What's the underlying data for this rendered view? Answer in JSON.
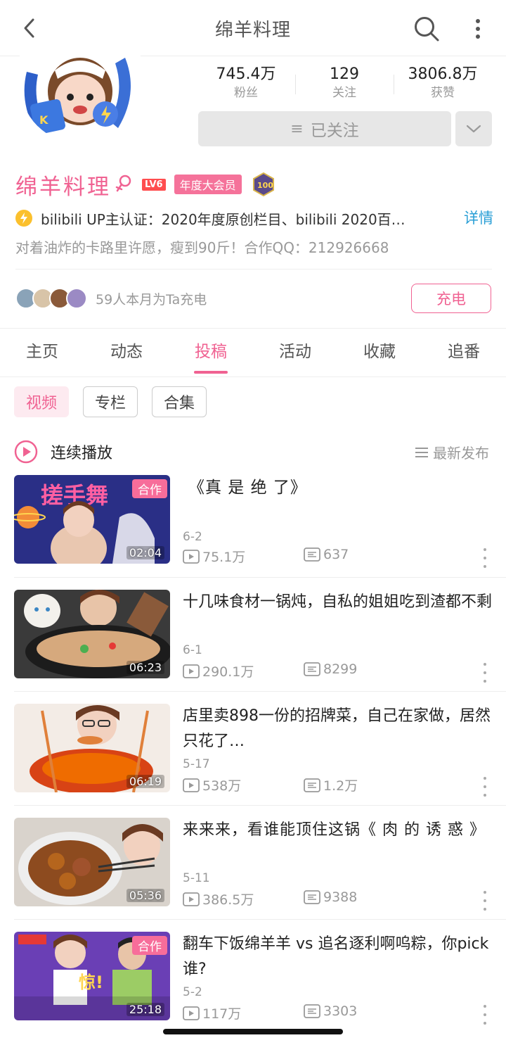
{
  "header": {
    "title": "绵羊料理"
  },
  "profile": {
    "stats": [
      {
        "value": "745.4万",
        "label": "粉丝"
      },
      {
        "value": "129",
        "label": "关注"
      },
      {
        "value": "3806.8万",
        "label": "获赞"
      }
    ],
    "follow_label": "已关注",
    "name": "绵羊料理",
    "level_badge": "LV6",
    "vip_badge": "年度大会员",
    "verify_text": "bilibili UP主认证：2020年度原创栏目、bilibili 2020百…",
    "detail_link": "详情",
    "bio": "对着油炸的卡路里许愿，瘦到90斤！合作QQ：212926668",
    "charge_text": "59人本月为Ta充电",
    "charge_button": "充电",
    "accent_color": "#f06292"
  },
  "tabs": [
    "主页",
    "动态",
    "投稿",
    "活动",
    "收藏",
    "追番"
  ],
  "active_tab": "投稿",
  "subtabs": [
    "视频",
    "专栏",
    "合集"
  ],
  "play_all": {
    "label": "连续播放",
    "sort_label": "最新发布"
  },
  "videos": [
    {
      "title": "《真 是 绝 了》",
      "date": "6-2",
      "views": "75.1万",
      "danmaku": "637",
      "duration": "02:04",
      "tag": "合作"
    },
    {
      "title": "十几味食材一锅炖，自私的姐姐吃到渣都不剩",
      "date": "6-1",
      "views": "290.1万",
      "danmaku": "8299",
      "duration": "06:23"
    },
    {
      "title": "店里卖898一份的招牌菜，自己在家做，居然只花了…",
      "date": "5-17",
      "views": "538万",
      "danmaku": "1.2万",
      "duration": "06:19"
    },
    {
      "title": "来来来，看谁能顶住这锅《 肉 的 诱 惑 》",
      "date": "5-11",
      "views": "386.5万",
      "danmaku": "9388",
      "duration": "05:36"
    },
    {
      "title": "翻车下饭绵羊羊 vs 追名逐利啊呜粽，你pick谁?",
      "date": "5-2",
      "views": "117万",
      "danmaku": "3303",
      "duration": "25:18",
      "tag": "合作"
    }
  ]
}
